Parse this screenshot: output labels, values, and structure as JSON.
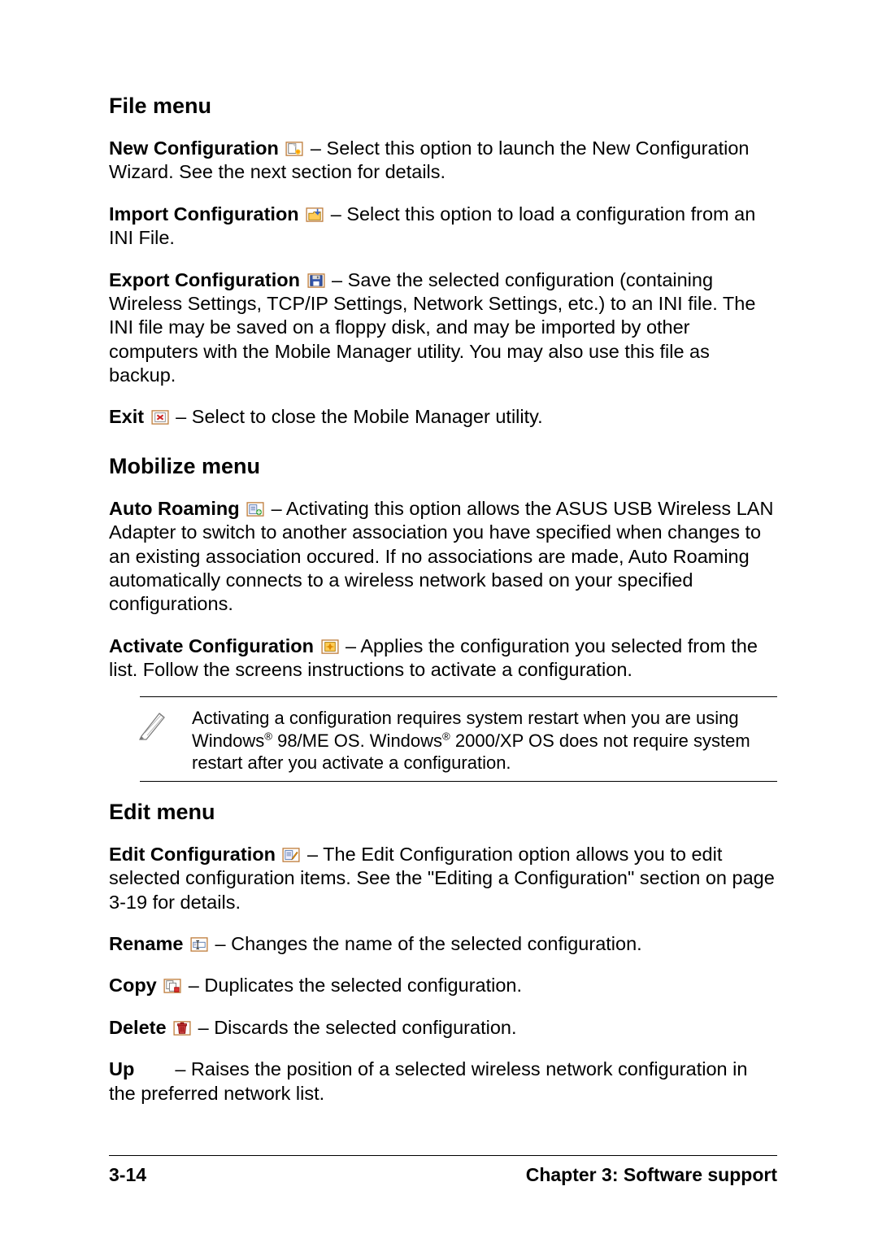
{
  "sections": {
    "file": {
      "heading": "File menu",
      "new_config_label": "New Configuration ",
      "new_config_text": " – Select this option to launch the New Configuration Wizard. See the next section for details.",
      "import_config_label": "Import Configuration ",
      "import_config_text": " – Select this option to load a configuration from an INI File.",
      "export_config_label": "Export Configuration ",
      "export_config_text": " – Save the selected configuration (containing Wireless Settings, TCP/IP Settings, Network Settings, etc.) to an INI file. The INI file may be saved on a floppy disk, and may be imported by other computers with the Mobile Manager utility. You may also use this file as backup.",
      "exit_label": "Exit ",
      "exit_text": " – Select to close the Mobile Manager utility."
    },
    "mobilize": {
      "heading": "Mobilize menu",
      "auto_roaming_label": "Auto Roaming ",
      "auto_roaming_text": " – Activating this option allows the ASUS USB Wireless LAN Adapter to switch to another association you have specified when changes to an existing association occured. If no associations are made, Auto Roaming automatically connects to a wireless network based on your specified configurations.",
      "activate_label": "Activate Configuration ",
      "activate_text": " – Applies the configuration you selected from the list. Follow the screens instructions to activate a configuration.",
      "note_pre": "Activating a configuration requires system restart when you are using Windows",
      "note_mid": " 98/ME OS. Windows",
      "note_post": " 2000/XP OS does not require system restart after you activate a configuration.",
      "reg": "®"
    },
    "edit": {
      "heading": "Edit menu",
      "edit_config_label": "Edit Configuration ",
      "edit_config_text": " – The Edit Configuration option allows you to edit selected configuration items. See the \"Editing a Configuration\" section on page 3-19 for details.",
      "rename_label": "Rename ",
      "rename_text": " – Changes the name of the selected configuration.",
      "copy_label": "Copy ",
      "copy_text": " – Duplicates the selected configuration.",
      "delete_label": "Delete ",
      "delete_text": " – Discards the selected configuration.",
      "up_label": "Up",
      "up_text": "– Raises the position of a selected wireless network configuration in the preferred network list."
    }
  },
  "footer": {
    "page": "3-14",
    "chapter": "Chapter 3: Software support"
  }
}
